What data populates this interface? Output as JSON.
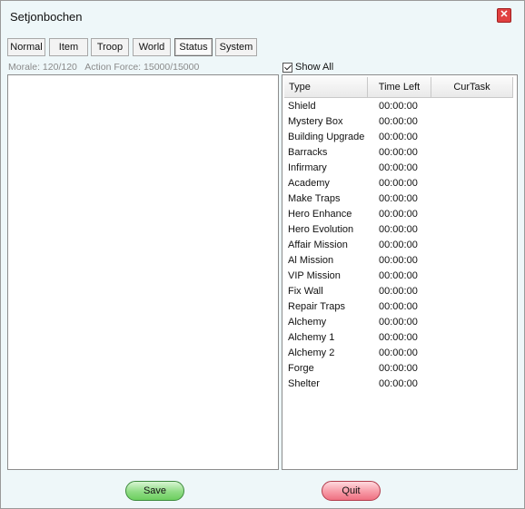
{
  "window": {
    "title": "Setjonbochen",
    "close_label": "✕"
  },
  "tabs": [
    "Normal",
    "Item",
    "Troop",
    "World",
    "Status",
    "System"
  ],
  "active_tab": "Status",
  "stats": {
    "morale": "Morale: 120/120",
    "action_force": "Action Force: 15000/15000"
  },
  "show_all": {
    "label": "Show All",
    "checked": true
  },
  "table": {
    "columns": [
      "Type",
      "Time Left",
      "CurTask"
    ],
    "rows": [
      {
        "type": "Shield",
        "time_left": "00:00:00",
        "cur_task": ""
      },
      {
        "type": "Mystery Box",
        "time_left": "00:00:00",
        "cur_task": ""
      },
      {
        "type": "Building Upgrade",
        "time_left": "00:00:00",
        "cur_task": ""
      },
      {
        "type": "Barracks",
        "time_left": "00:00:00",
        "cur_task": ""
      },
      {
        "type": "Infirmary",
        "time_left": "00:00:00",
        "cur_task": ""
      },
      {
        "type": "Academy",
        "time_left": "00:00:00",
        "cur_task": ""
      },
      {
        "type": "Make Traps",
        "time_left": "00:00:00",
        "cur_task": ""
      },
      {
        "type": "Hero Enhance",
        "time_left": "00:00:00",
        "cur_task": ""
      },
      {
        "type": "Hero Evolution",
        "time_left": "00:00:00",
        "cur_task": ""
      },
      {
        "type": "Affair Mission",
        "time_left": "00:00:00",
        "cur_task": ""
      },
      {
        "type": "Al Mission",
        "time_left": "00:00:00",
        "cur_task": ""
      },
      {
        "type": "VIP Mission",
        "time_left": "00:00:00",
        "cur_task": ""
      },
      {
        "type": "Fix Wall",
        "time_left": "00:00:00",
        "cur_task": ""
      },
      {
        "type": "Repair Traps",
        "time_left": "00:00:00",
        "cur_task": ""
      },
      {
        "type": "Alchemy",
        "time_left": "00:00:00",
        "cur_task": ""
      },
      {
        "type": "Alchemy 1",
        "time_left": "00:00:00",
        "cur_task": ""
      },
      {
        "type": "Alchemy 2",
        "time_left": "00:00:00",
        "cur_task": ""
      },
      {
        "type": "Forge",
        "time_left": "00:00:00",
        "cur_task": ""
      },
      {
        "type": "Shelter",
        "time_left": "00:00:00",
        "cur_task": ""
      }
    ]
  },
  "buttons": {
    "save": "Save",
    "quit": "Quit"
  },
  "icons": {
    "close": "close-icon",
    "checkbox": "checkmark-icon"
  },
  "colors": {
    "save": "#8fdc84",
    "quit": "#f79aa6",
    "close": "#e04040"
  }
}
